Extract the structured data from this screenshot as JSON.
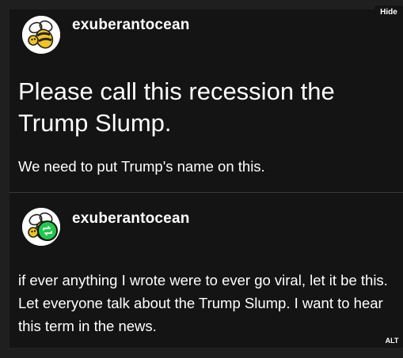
{
  "controls": {
    "hide_label": "Hide",
    "alt_label": "ALT"
  },
  "post": {
    "username": "exuberantocean",
    "avatar_icon": "bee-icon",
    "headline": "Please call this recession the Trump Slump.",
    "subtext": "We need to put Trump's name on this."
  },
  "reblog": {
    "username": "exuberantocean",
    "avatar_icon": "bee-icon",
    "badge_icon": "reblog-icon",
    "text": "if ever anything I wrote were to ever go viral, let it be this.  Let everyone talk about the Trump Slump.  I want to hear this term in the news."
  },
  "colors": {
    "background": "#1f1f20",
    "post_background": "#141414",
    "text": "#ffffff",
    "reblog_badge": "#1fc94a",
    "divider": "#3a3a3a"
  }
}
